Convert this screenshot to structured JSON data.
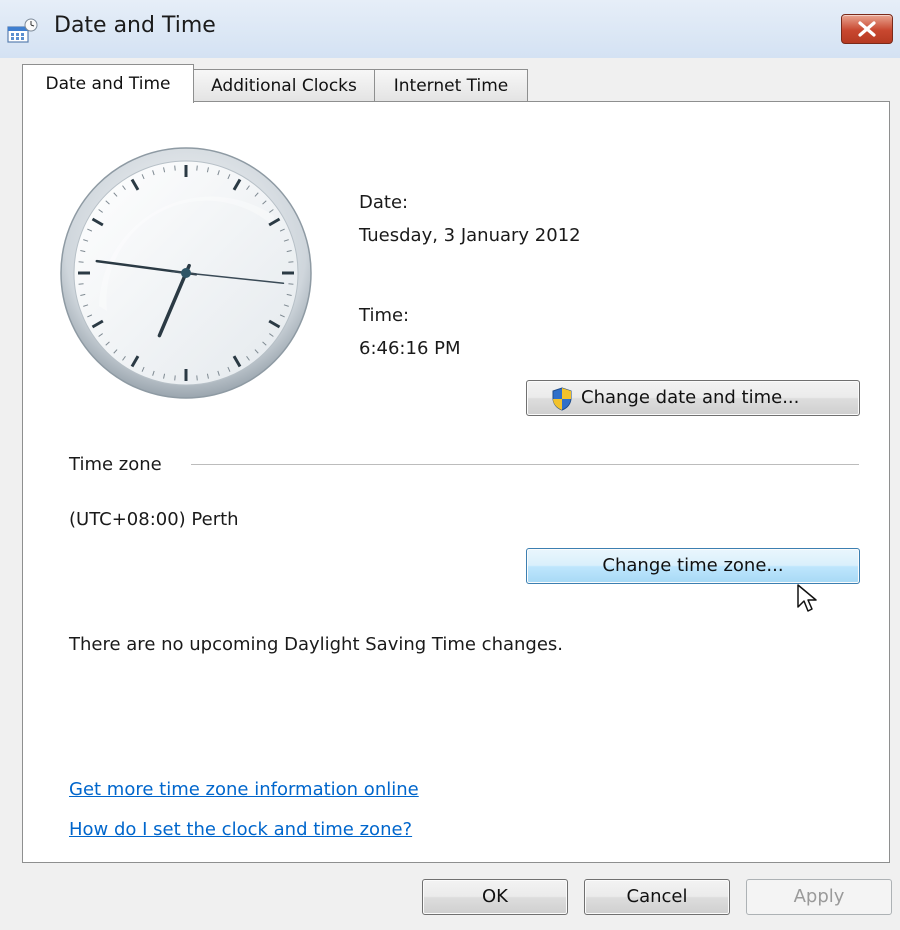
{
  "window": {
    "title": "Date and Time",
    "icon": "calendar-clock-icon",
    "close_icon": "close-icon"
  },
  "tabs": [
    {
      "label": "Date and Time",
      "active": true
    },
    {
      "label": "Additional Clocks",
      "active": false
    },
    {
      "label": "Internet Time",
      "active": false
    }
  ],
  "clock": {
    "hours": 6,
    "minutes": 46,
    "seconds": 16
  },
  "date": {
    "label": "Date:",
    "value": "Tuesday, 3 January 2012"
  },
  "time": {
    "label": "Time:",
    "value": "6:46:16 PM"
  },
  "change_datetime_button": {
    "label": "Change date and time...",
    "icon": "uac-shield-icon"
  },
  "timezone": {
    "section_label": "Time zone",
    "value": "(UTC+08:00) Perth",
    "change_button": "Change time zone...",
    "dst_note": "There are no upcoming Daylight Saving Time changes."
  },
  "links": [
    "Get more time zone information online",
    "How do I set the clock and time zone?"
  ],
  "footer": {
    "ok": "OK",
    "cancel": "Cancel",
    "apply": "Apply"
  },
  "colors": {
    "link": "#0066cc",
    "close": "#c8472f",
    "hover_button": "#bee6fd"
  }
}
